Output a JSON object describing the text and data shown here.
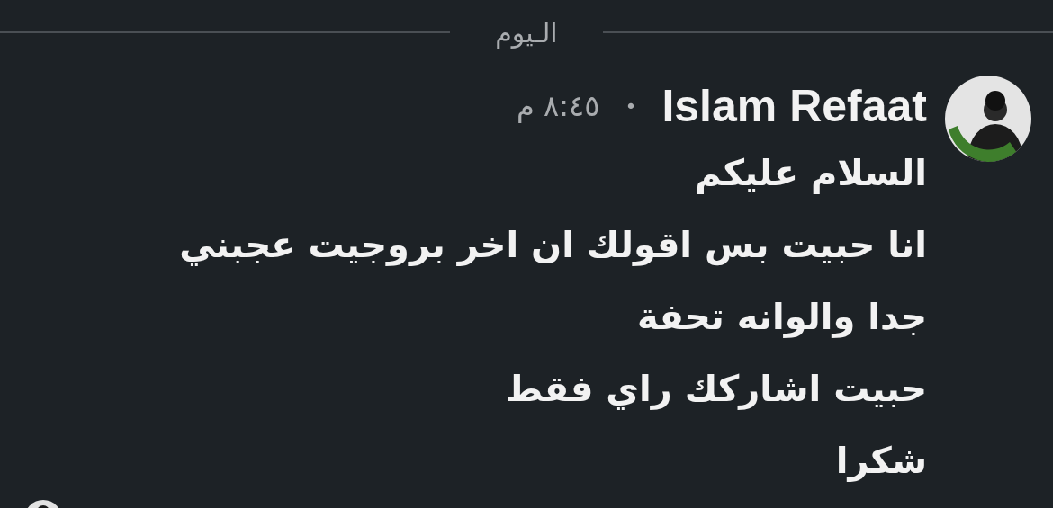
{
  "date_divider": {
    "label": "الـيوم"
  },
  "message": {
    "sender": "Islam Refaat",
    "separator": "•",
    "time": "٨:٤٥ م",
    "lines": [
      "السلام عليكم",
      "انا حبيت بس اقولك ان اخر بروجيت عجبني",
      "جدا والوانه تحفة",
      "حبيت اشاركك راي فقط",
      "شكرا"
    ]
  }
}
